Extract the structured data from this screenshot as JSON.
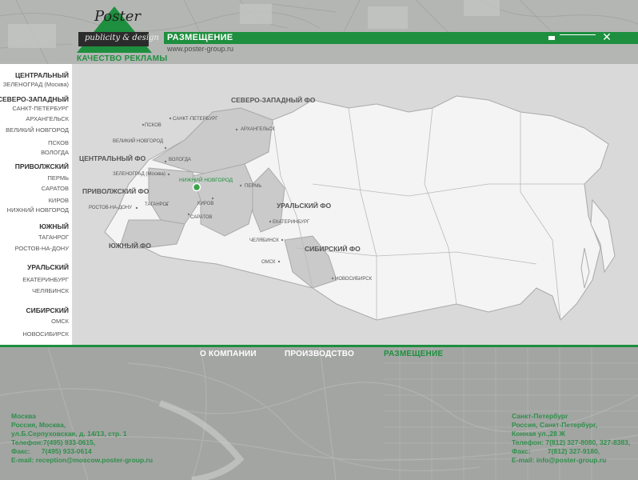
{
  "header": {
    "logo_script": "Poster",
    "logo_sub": "publicity & design",
    "tagline": "КАЧЕСТВО РЕКЛАМЫ",
    "page_title": "РАЗМЕЩЕНИЕ",
    "url": "www.poster-group.ru",
    "close_glyph": "✕"
  },
  "sidebar": {
    "groups": [
      {
        "label": "ЦЕНТРАЛЬНЫЙ",
        "cities": [
          "ЗЕЛЕНОГРАД (Москва)"
        ]
      },
      {
        "label": "СЕВЕРО-ЗАПАДНЫЙ",
        "cities": [
          "САНКТ-ПЕТЕРБУРГ",
          "АРХАНГЕЛЬСК",
          "ВЕЛИКИЙ НОВГОРОД",
          "ПСКОВ",
          "ВОЛОГДА"
        ]
      },
      {
        "label": "ПРИВОЛЖСКИЙ",
        "cities": [
          "ПЕРМЬ",
          "САРАТОВ",
          "КИРОВ",
          "НИЖНИЙ НОВГОРОД"
        ]
      },
      {
        "label": "ЮЖНЫЙ",
        "cities": [
          "ТАГАНРОГ",
          "РОСТОВ-НА-ДОНУ"
        ]
      },
      {
        "label": "УРАЛЬСКИЙ",
        "cities": [
          "ЕКАТЕРИНБУРГ",
          "ЧЕЛЯБИНСК"
        ]
      },
      {
        "label": "СИБИРСКИЙ",
        "cities": [
          "ОМСК",
          "НОВОСИБИРСК"
        ]
      }
    ]
  },
  "map": {
    "districts": [
      "СЕВЕРО-ЗАПАДНЫЙ ФО",
      "ЦЕНТРАЛЬНЫЙ ФО",
      "ПРИВОЛЖСКИЙ ФО",
      "ЮЖНЫЙ ФО",
      "УРАЛЬСКИЙ ФО",
      "СИБИРСКИЙ ФО"
    ],
    "cities": [
      "САНКТ-ПЕТЕРБУРГ",
      "ПСКОВ",
      "АРХАНГЕЛЬСК",
      "ВЕЛИКИЙ НОВГОРОД",
      "ВОЛОГДА",
      "ЗЕЛЕНОГРАД (Москва)",
      "ПЕРМЬ",
      "КИРОВ",
      "РОСТОВ-НА-ДОНУ",
      "ТАГАНРОГ",
      "САРАТОВ",
      "ЕКАТЕРИНБУРГ",
      "ЧЕЛЯБИНСК",
      "ОМСК",
      "НОВОСИБИРСК"
    ],
    "highlight_city": "НИЖНИЙ НОВГОРОД"
  },
  "nav": {
    "about": "О КОМПАНИИ",
    "production": "ПРОИЗВОДСТВО",
    "placement": "РАЗМЕЩЕНИЕ"
  },
  "footer": {
    "moscow": "Москва\nРоссия, Москва,\nул.Б.Серпуховская, д. 14/13, стр. 1\nТелефон:7(495) 933-0615,\nФакс:      7(495) 933-0614\nE-mail: reception@moscow.poster-group.ru",
    "spb": "Санкт-Петербург\nРоссия, Санкт-Петербург,\nКонная ул.,28 Ж\nТелефон: 7(812) 327-8080, 327-8383,\nФакс:         7(812) 327-9180,\nE-mail: info@poster-group.ru"
  },
  "colors": {
    "accent": "#1e8f3e",
    "map_bg": "#d8d9d8",
    "land": "#f4f4f4",
    "district_hl": "#c9cac9"
  }
}
